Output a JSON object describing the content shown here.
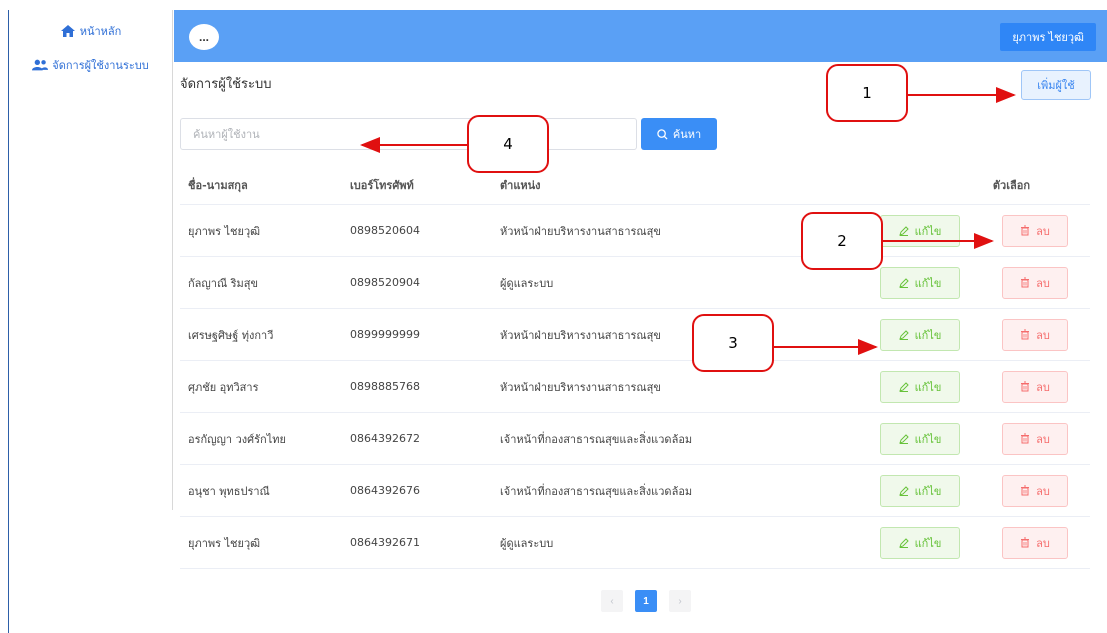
{
  "sidebar": {
    "items": [
      {
        "label": "หน้าหลัก",
        "icon": "home-icon"
      },
      {
        "label": "จัดการผู้ใช้งานระบบ",
        "icon": "users-icon"
      }
    ]
  },
  "header": {
    "menu_label": "...",
    "user_name": "ยุภาพร ไชยวุฒิ",
    "bg_color": "#5aa0f5"
  },
  "main": {
    "title": "จัดการผู้ใช้ระบบ",
    "add_user_label": "เพิ่มผู้ใช้",
    "search": {
      "placeholder": "ค้นหาผู้ใช้งาน",
      "value": "",
      "button_label": "ค้นหา"
    },
    "table": {
      "headers": {
        "name": "ชื่อ-นามสกุล",
        "phone": "เบอร์โทรศัพท์",
        "position": "ตำแหน่ง",
        "options": "ตัวเลือก"
      },
      "edit_label": "แก้ไข",
      "delete_label": "ลบ",
      "rows": [
        {
          "name": "ยุภาพร ไชยวุฒิ",
          "phone": "0898520604",
          "position": "หัวหน้าฝ่ายบริหารงานสาธารณสุข"
        },
        {
          "name": "กัลญาณี ริมสุข",
          "phone": "0898520904",
          "position": "ผู้ดูแลระบบ"
        },
        {
          "name": "เศรษฐศิษฐ์ ทุ่งกาวี",
          "phone": "0899999999",
          "position": "หัวหน้าฝ่ายบริหารงานสาธารณสุข"
        },
        {
          "name": "ศุภชัย อุทวิสาร",
          "phone": "0898885768",
          "position": "หัวหน้าฝ่ายบริหารงานสาธารณสุข"
        },
        {
          "name": "อรกัญญา วงศ์รักไทย",
          "phone": "0864392672",
          "position": "เจ้าหน้าที่กองสาธารณสุขและสิ่งแวดล้อม"
        },
        {
          "name": "อนุชา พุทธปราณี",
          "phone": "0864392676",
          "position": "เจ้าหน้าที่กองสาธารณสุขและสิ่งแวดล้อม"
        },
        {
          "name": "ยุภาพร ไชยวุฒิ",
          "phone": "0864392671",
          "position": "ผู้ดูแลระบบ"
        }
      ]
    },
    "pagination": {
      "current_page": "1",
      "prev": "‹",
      "next": "›"
    }
  },
  "callouts": [
    "1",
    "2",
    "3",
    "4"
  ]
}
